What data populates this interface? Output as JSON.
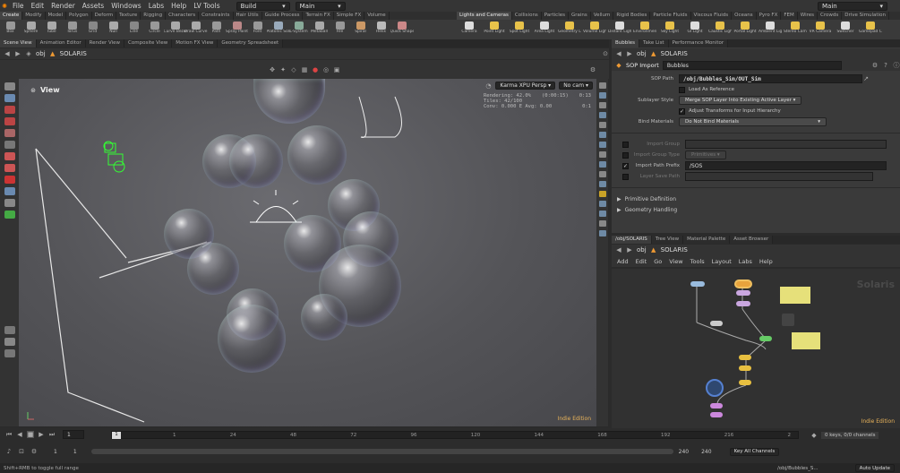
{
  "menubar": {
    "items": [
      "File",
      "Edit",
      "Render",
      "Assets",
      "Windows",
      "Labs",
      "Help",
      "LV Tools"
    ],
    "desktop": "Build",
    "network": "Main",
    "top_right": "Main"
  },
  "shelf_tabs": [
    "Create",
    "Modify",
    "Model",
    "Polygon",
    "Deform",
    "Texture",
    "Rigging",
    "Characters",
    "Constraints",
    "Hair Utils",
    "Guide Process",
    "Terrain FX",
    "Simple FX",
    "Volume"
  ],
  "shelf_tabs_right": [
    "Lights and Cameras",
    "Collisions",
    "Particles",
    "Grains",
    "Vellum",
    "Rigid Bodies",
    "Particle Fluids",
    "Viscous Fluids",
    "Oceans",
    "Pyro FX",
    "FEM",
    "Wires",
    "Crowds",
    "Drive Simulation"
  ],
  "tools_left": [
    "Box",
    "Sphere",
    "Tube",
    "Torus",
    "Grid",
    "Null",
    "Line",
    "Circle",
    "Curve Bezier",
    "Draw Curve",
    "Path",
    "Spray Paint",
    "Font",
    "Platonic Solids",
    "L-System",
    "Metaball",
    "File",
    "Spiral",
    "Helix",
    "Quick Shapes"
  ],
  "tools_right": [
    "Camera",
    "Point Light",
    "Spot Light",
    "Area Light",
    "Geometry Light",
    "Volume Light",
    "Distant Light",
    "Environment Light",
    "Sky Light",
    "GI Light",
    "Caustic Light",
    "Portal Light",
    "Ambient Light",
    "Stereo Camera",
    "VR Camera",
    "Switcher",
    "Gamepad Ca"
  ],
  "left_pane_tabs": [
    "Scene View",
    "Animation Editor",
    "Render View",
    "Composite View",
    "Motion FX View",
    "Geometry Spreadsheet"
  ],
  "left_path": {
    "obj": "obj",
    "context": "SOLARIS"
  },
  "viewport": {
    "label": "View",
    "renderer": "Karma XPU",
    "persp": "Persp",
    "cam": "No cam",
    "stats": [
      "Rendering: 42.0%",
      "(0:00:15)",
      "0:13",
      "Tiles: 42/100",
      "",
      "Conv: 0.000 E Avg: 0.00",
      "0:1"
    ],
    "watermark": "Indie Edition"
  },
  "params": {
    "tabs": [
      "Bubbles",
      "Take List",
      "Performance Monitor"
    ],
    "path": {
      "obj": "obj",
      "context": "SOLARIS"
    },
    "node_type": "SOP Import",
    "node_name": "Bubbles",
    "sop_path_label": "SOP Path",
    "sop_path": "/obj/Bubbles_Sim/OUT_Sim",
    "load_as_reference": "Load As Reference",
    "sublayer_style_label": "Sublayer Style",
    "sublayer_style": "Merge SOP Layer Into Existing Active Layer",
    "adjust_transforms": "Adjust Transforms for Input Hierarchy",
    "bind_materials_label": "Bind Materials",
    "bind_materials": "Do Not Bind Materials",
    "import_group_label": "Import Group",
    "import_group_type_label": "Import Group Type",
    "import_group_type": "Primitives",
    "import_path_prefix_label": "Import Path Prefix",
    "import_path_prefix": "/SOS",
    "layer_save_path_label": "Layer Save Path",
    "sections": [
      "Primitive Definition",
      "Geometry Handling"
    ]
  },
  "network": {
    "tabs": [
      "/obj/SOLARIS",
      "Tree View",
      "Material Palette",
      "Asset Browser"
    ],
    "path": {
      "obj": "obj",
      "context": "SOLARIS"
    },
    "menu": [
      "Add",
      "Edit",
      "Go",
      "View",
      "Tools",
      "Layout",
      "Labs",
      "Help"
    ],
    "context_label": "Solaris",
    "watermark": "Indie Edition"
  },
  "timeline": {
    "frame": "1",
    "ticks": [
      "1",
      "24",
      "48",
      "72",
      "96",
      "120",
      "144",
      "168",
      "192",
      "216",
      "2"
    ],
    "start": "1",
    "start2": "1",
    "end": "240",
    "end2": "240",
    "keys": "0 keys, 0/0 channels",
    "key_all": "Key All Channels",
    "status": "Shift+RMB to toggle full range",
    "path": "/obj/Bubbles_S...",
    "auto_update": "Auto Update"
  }
}
